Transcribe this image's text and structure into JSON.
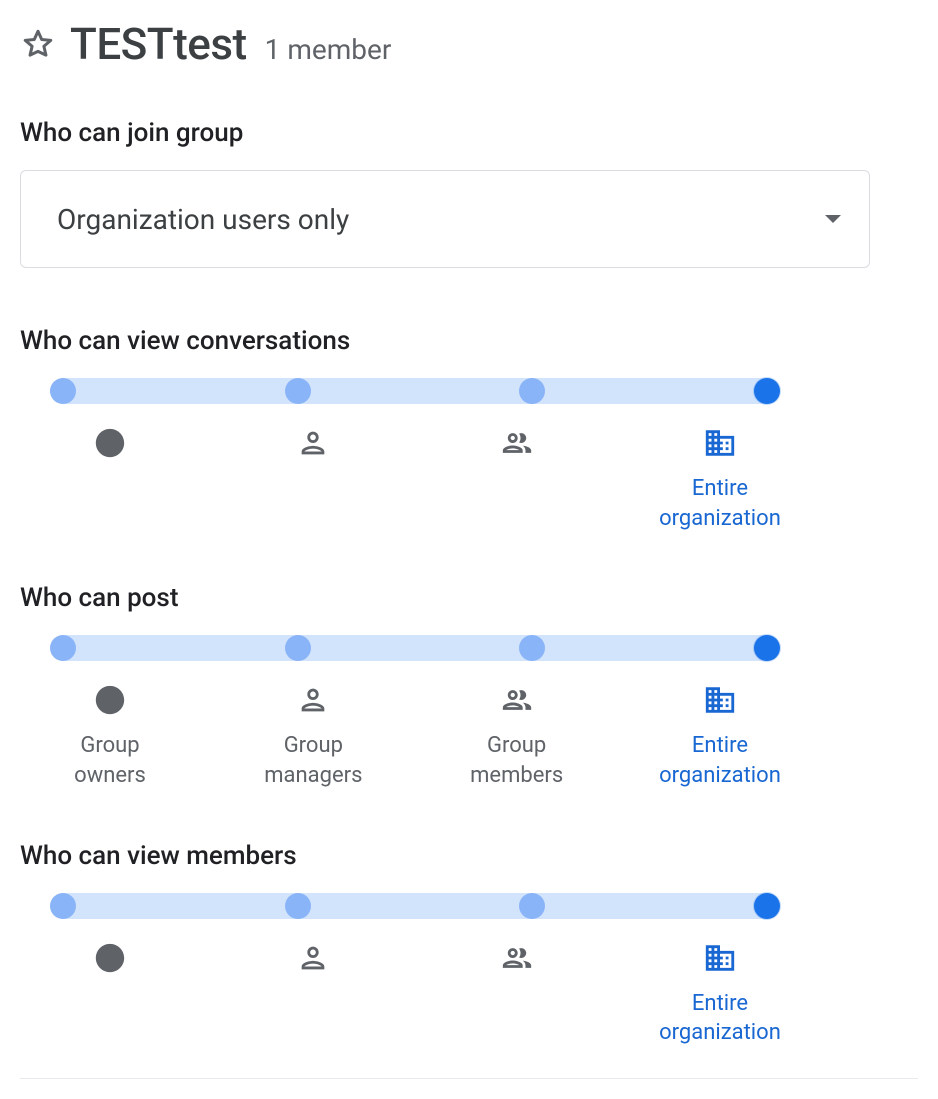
{
  "header": {
    "title": "TESTtest",
    "member_count": "1 member"
  },
  "who_can_join": {
    "heading": "Who can join group",
    "selected": "Organization users only"
  },
  "roles": {
    "owners": "Group owners",
    "managers": "Group managers",
    "members": "Group members",
    "org": "Entire organization"
  },
  "sections": {
    "view_conv": {
      "heading": "Who can view conversations",
      "selected_index": 3,
      "show_labels": false
    },
    "post": {
      "heading": "Who can post",
      "selected_index": 3,
      "show_labels": true
    },
    "view_members": {
      "heading": "Who can view members",
      "selected_index": 3,
      "show_labels": false
    }
  },
  "icons": {
    "star": "star-outline",
    "owner": "account-circle",
    "manager": "person-outline",
    "member": "people-outline",
    "org": "domain"
  },
  "colors": {
    "accent": "#1a73e8",
    "accent_text": "#1967d2",
    "track": "#d2e3fc",
    "stop": "#8ab4f8",
    "muted": "#5f6368"
  }
}
